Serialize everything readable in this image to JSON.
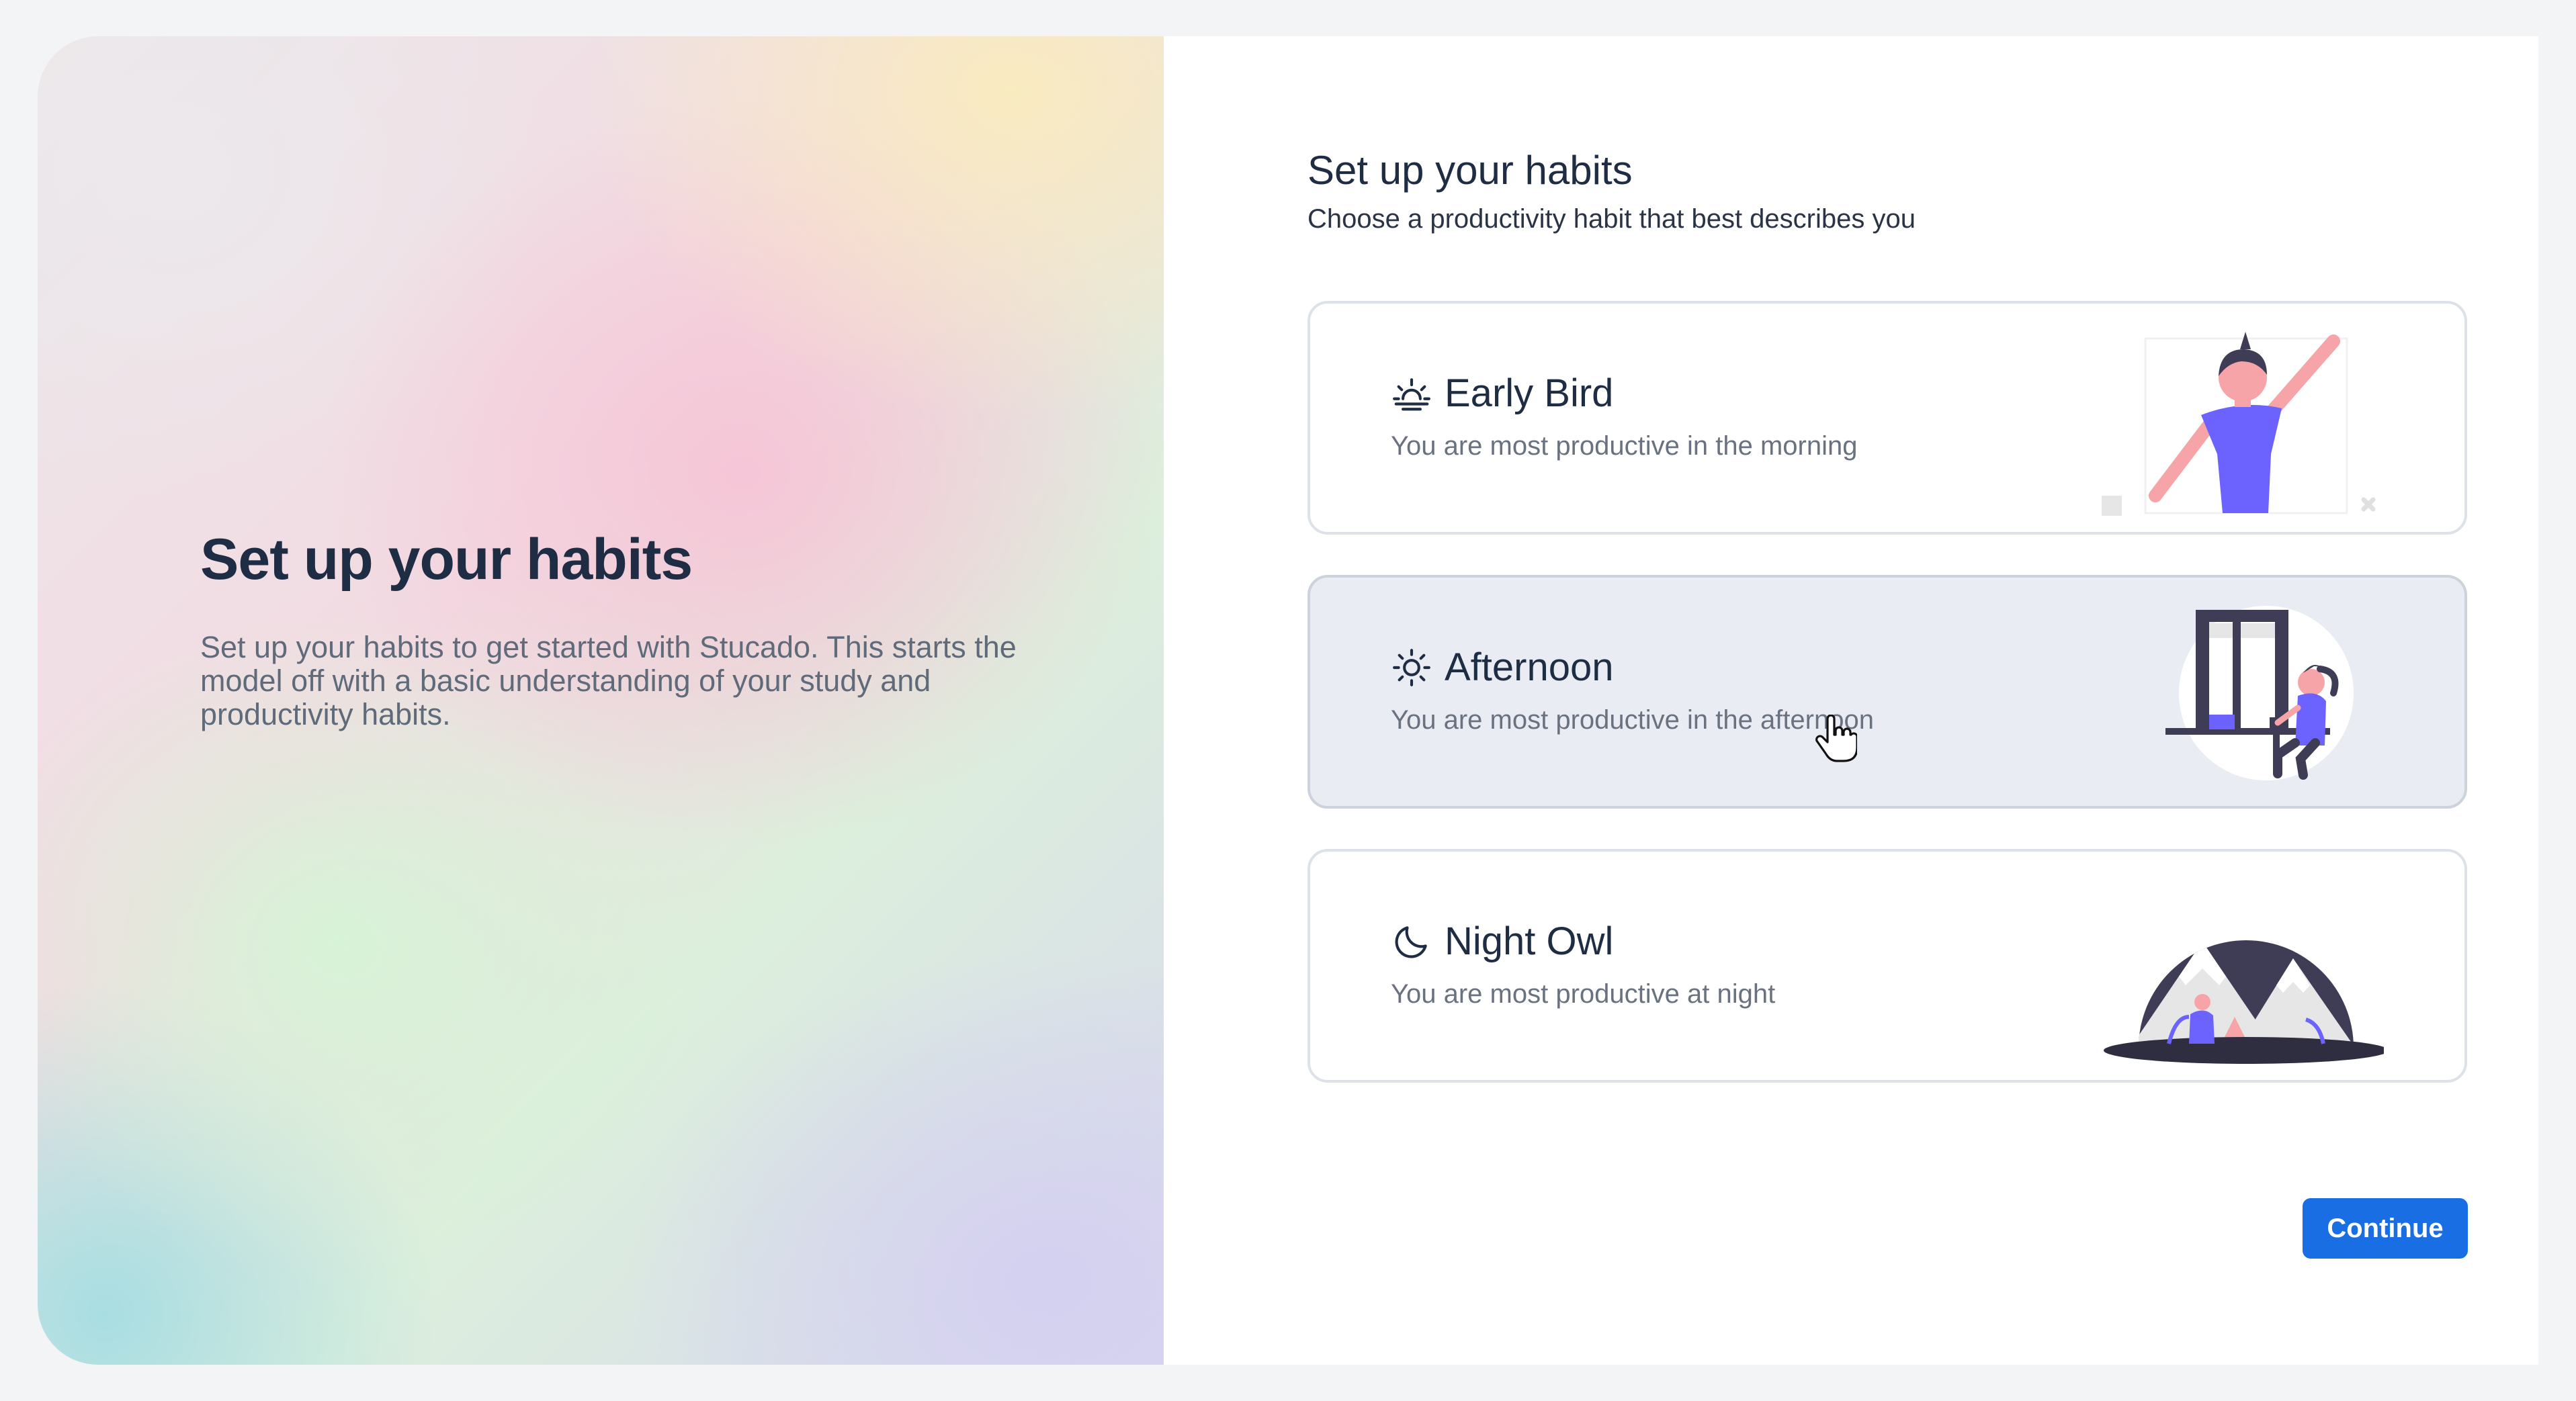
{
  "intro": {
    "title": "Set up your habits",
    "description": "Set up your habits to get started with Stucado. This starts the model off with a basic understanding of your study and productivity habits."
  },
  "form": {
    "title": "Set up your habits",
    "subtitle": "Choose a productivity habit that best describes you",
    "options": [
      {
        "title": "Early Bird",
        "description": "You are most productive in the morning",
        "icon": "sunrise-icon"
      },
      {
        "title": "Afternoon",
        "description": "You are most productive in the afternoon",
        "icon": "sun-icon",
        "hovered": true
      },
      {
        "title": "Night Owl",
        "description": "You are most productive at night",
        "icon": "moon-icon"
      }
    ],
    "continue_label": "Continue"
  },
  "colors": {
    "accent": "#1a6ee3",
    "illustration_purple": "#6c63ff",
    "illustration_pink": "#f7a4a8",
    "illustration_dark": "#3f3d56"
  }
}
